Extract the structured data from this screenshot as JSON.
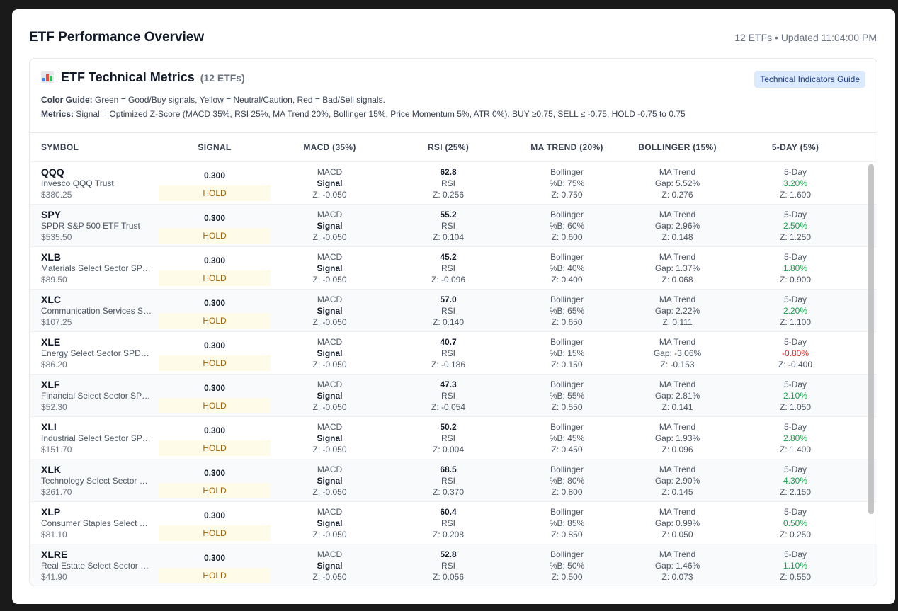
{
  "page": {
    "title": "ETF Performance Overview",
    "meta": "12 ETFs • Updated 11:04:00 PM"
  },
  "card": {
    "title": "ETF Technical Metrics",
    "count": "(12 ETFs)",
    "guide_button": "Technical Indicators Guide",
    "color_guide_label": "Color Guide:",
    "color_guide_text": " Green = Good/Buy signals, Yellow = Neutral/Caution, Red = Bad/Sell signals.",
    "metrics_label": "Metrics:",
    "metrics_text": " Signal = Optimized Z-Score (MACD 35%, RSI 25%, MA Trend 20%, Bollinger 15%, Price Momentum 5%, ATR 0%). BUY ≥0.75, SELL ≤ -0.75, HOLD -0.75 to 0.75"
  },
  "columns": [
    "SYMBOL",
    "SIGNAL",
    "MACD (35%)",
    "RSI (25%)",
    "MA TREND (20%)",
    "BOLLINGER (15%)",
    "5-DAY (5%)"
  ],
  "colors": {
    "pos": "#16a34a",
    "neg": "#dc2626",
    "hold_bg": "#fefce8",
    "hold_fg": "#a16207",
    "guide_bg": "#dbeafe"
  },
  "rows": [
    {
      "symbol": "QQQ",
      "name": "Invesco QQQ Trust",
      "price": "$380.25",
      "signal": "0.300",
      "action": "HOLD",
      "macd": [
        "MACD",
        "Signal",
        "Z: -0.050"
      ],
      "rsi": [
        "62.8",
        "RSI",
        "Z: 0.256"
      ],
      "col5": [
        "Bollinger",
        "%B: 75%",
        "Z: 0.750"
      ],
      "col6": [
        "MA Trend",
        "Gap: 5.52%",
        "Z: 0.276"
      ],
      "day": [
        "5-Day",
        "3.20%",
        "Z: 1.600"
      ],
      "day_dir": "pos"
    },
    {
      "symbol": "SPY",
      "name": "SPDR S&P 500 ETF Trust",
      "price": "$535.50",
      "signal": "0.300",
      "action": "HOLD",
      "macd": [
        "MACD",
        "Signal",
        "Z: -0.050"
      ],
      "rsi": [
        "55.2",
        "RSI",
        "Z: 0.104"
      ],
      "col5": [
        "Bollinger",
        "%B: 60%",
        "Z: 0.600"
      ],
      "col6": [
        "MA Trend",
        "Gap: 2.96%",
        "Z: 0.148"
      ],
      "day": [
        "5-Day",
        "2.50%",
        "Z: 1.250"
      ],
      "day_dir": "pos"
    },
    {
      "symbol": "XLB",
      "name": "Materials Select Sector SPDR Fund",
      "price": "$89.50",
      "signal": "0.300",
      "action": "HOLD",
      "macd": [
        "MACD",
        "Signal",
        "Z: -0.050"
      ],
      "rsi": [
        "45.2",
        "RSI",
        "Z: -0.096"
      ],
      "col5": [
        "Bollinger",
        "%B: 40%",
        "Z: 0.400"
      ],
      "col6": [
        "MA Trend",
        "Gap: 1.37%",
        "Z: 0.068"
      ],
      "day": [
        "5-Day",
        "1.80%",
        "Z: 0.900"
      ],
      "day_dir": "pos"
    },
    {
      "symbol": "XLC",
      "name": "Communication Services Select Sector SPDR Fund",
      "price": "$107.25",
      "signal": "0.300",
      "action": "HOLD",
      "macd": [
        "MACD",
        "Signal",
        "Z: -0.050"
      ],
      "rsi": [
        "57.0",
        "RSI",
        "Z: 0.140"
      ],
      "col5": [
        "Bollinger",
        "%B: 65%",
        "Z: 0.650"
      ],
      "col6": [
        "MA Trend",
        "Gap: 2.22%",
        "Z: 0.111"
      ],
      "day": [
        "5-Day",
        "2.20%",
        "Z: 1.100"
      ],
      "day_dir": "pos"
    },
    {
      "symbol": "XLE",
      "name": "Energy Select Sector SPDR Fund",
      "price": "$86.20",
      "signal": "0.300",
      "action": "HOLD",
      "macd": [
        "MACD",
        "Signal",
        "Z: -0.050"
      ],
      "rsi": [
        "40.7",
        "RSI",
        "Z: -0.186"
      ],
      "col5": [
        "Bollinger",
        "%B: 15%",
        "Z: 0.150"
      ],
      "col6": [
        "MA Trend",
        "Gap: -3.06%",
        "Z: -0.153"
      ],
      "day": [
        "5-Day",
        "-0.80%",
        "Z: -0.400"
      ],
      "day_dir": "neg"
    },
    {
      "symbol": "XLF",
      "name": "Financial Select Sector SPDR Fund",
      "price": "$52.30",
      "signal": "0.300",
      "action": "HOLD",
      "macd": [
        "MACD",
        "Signal",
        "Z: -0.050"
      ],
      "rsi": [
        "47.3",
        "RSI",
        "Z: -0.054"
      ],
      "col5": [
        "Bollinger",
        "%B: 55%",
        "Z: 0.550"
      ],
      "col6": [
        "MA Trend",
        "Gap: 2.81%",
        "Z: 0.141"
      ],
      "day": [
        "5-Day",
        "2.10%",
        "Z: 1.050"
      ],
      "day_dir": "pos"
    },
    {
      "symbol": "XLI",
      "name": "Industrial Select Sector SPDR Fund",
      "price": "$151.70",
      "signal": "0.300",
      "action": "HOLD",
      "macd": [
        "MACD",
        "Signal",
        "Z: -0.050"
      ],
      "rsi": [
        "50.2",
        "RSI",
        "Z: 0.004"
      ],
      "col5": [
        "Bollinger",
        "%B: 45%",
        "Z: 0.450"
      ],
      "col6": [
        "MA Trend",
        "Gap: 1.93%",
        "Z: 0.096"
      ],
      "day": [
        "5-Day",
        "2.80%",
        "Z: 1.400"
      ],
      "day_dir": "pos"
    },
    {
      "symbol": "XLK",
      "name": "Technology Select Sector SPDR Fund",
      "price": "$261.70",
      "signal": "0.300",
      "action": "HOLD",
      "macd": [
        "MACD",
        "Signal",
        "Z: -0.050"
      ],
      "rsi": [
        "68.5",
        "RSI",
        "Z: 0.370"
      ],
      "col5": [
        "Bollinger",
        "%B: 80%",
        "Z: 0.800"
      ],
      "col6": [
        "MA Trend",
        "Gap: 2.90%",
        "Z: 0.145"
      ],
      "day": [
        "5-Day",
        "4.30%",
        "Z: 2.150"
      ],
      "day_dir": "pos"
    },
    {
      "symbol": "XLP",
      "name": "Consumer Staples Select Sector SPDR Fund",
      "price": "$81.10",
      "signal": "0.300",
      "action": "HOLD",
      "macd": [
        "MACD",
        "Signal",
        "Z: -0.050"
      ],
      "rsi": [
        "60.4",
        "RSI",
        "Z: 0.208"
      ],
      "col5": [
        "Bollinger",
        "%B: 85%",
        "Z: 0.850"
      ],
      "col6": [
        "MA Trend",
        "Gap: 0.99%",
        "Z: 0.050"
      ],
      "day": [
        "5-Day",
        "0.50%",
        "Z: 0.250"
      ],
      "day_dir": "pos"
    },
    {
      "symbol": "XLRE",
      "name": "Real Estate Select Sector SPDR Fund",
      "price": "$41.90",
      "signal": "0.300",
      "action": "HOLD",
      "macd": [
        "MACD",
        "Signal",
        "Z: -0.050"
      ],
      "rsi": [
        "52.8",
        "RSI",
        "Z: 0.056"
      ],
      "col5": [
        "Bollinger",
        "%B: 50%",
        "Z: 0.500"
      ],
      "col6": [
        "MA Trend",
        "Gap: 1.46%",
        "Z: 0.073"
      ],
      "day": [
        "5-Day",
        "1.10%",
        "Z: 0.550"
      ],
      "day_dir": "pos"
    }
  ]
}
